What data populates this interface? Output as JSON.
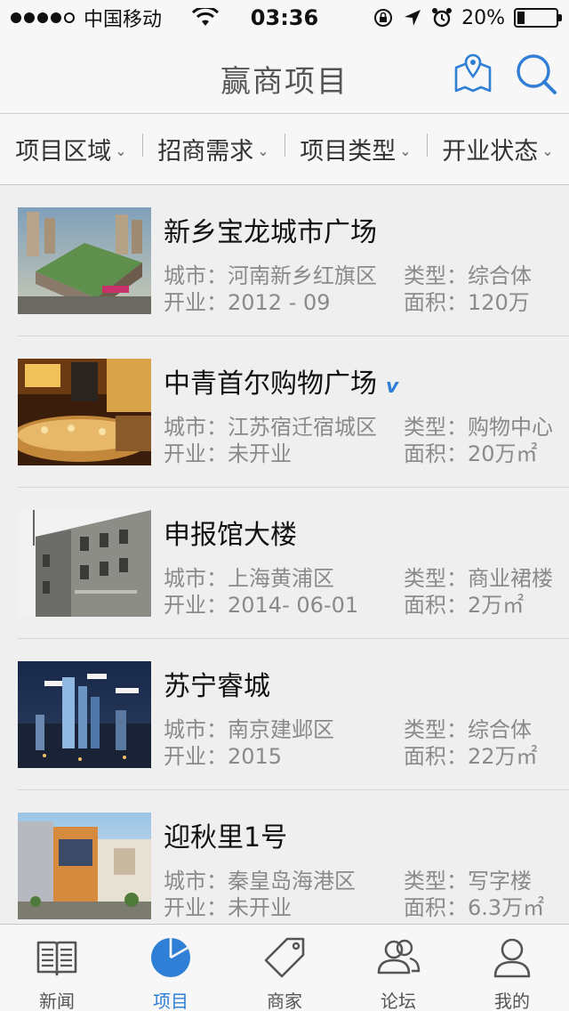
{
  "status_bar": {
    "carrier": "中国移动",
    "time": "03:36",
    "battery_text": "20%",
    "battery_level": 0.2
  },
  "nav": {
    "title": "赢商项目",
    "map_icon": "map-pin-icon",
    "search_icon": "search-icon"
  },
  "filters": [
    {
      "label": "项目区域"
    },
    {
      "label": "招商需求"
    },
    {
      "label": "项目类型"
    },
    {
      "label": "开业状态"
    }
  ],
  "items": [
    {
      "name": "新乡宝龙城市广场",
      "verified": false,
      "city": "城市：河南新乡红旗区",
      "open": "开业：2012 - 09",
      "type": "类型：综合体",
      "area": "面积：120万"
    },
    {
      "name": "中青首尔购物广场",
      "verified": true,
      "city": "城市：江苏宿迁宿城区",
      "open": "开业：未开业",
      "type": "类型：购物中心",
      "area": "面积：20万㎡"
    },
    {
      "name": "申报馆大楼",
      "verified": false,
      "city": "城市：上海黄浦区",
      "open": "开业：2014- 06-01",
      "type": "类型：商业裙楼",
      "area": "面积：2万㎡"
    },
    {
      "name": "苏宁睿城",
      "verified": false,
      "city": "城市：南京建邺区",
      "open": "开业：2015",
      "type": "类型：综合体",
      "area": "面积：22万㎡"
    },
    {
      "name": "迎秋里1号",
      "verified": false,
      "city": "城市：秦皇岛海港区",
      "open": "开业：未开业",
      "type": "类型：写字楼",
      "area": "面积：6.3万㎡"
    }
  ],
  "verified_badge": "v",
  "tabs": [
    {
      "label": "新闻",
      "icon": "newspaper-icon",
      "active": false
    },
    {
      "label": "项目",
      "icon": "pie-chart-icon",
      "active": true
    },
    {
      "label": "商家",
      "icon": "tag-icon",
      "active": false
    },
    {
      "label": "论坛",
      "icon": "users-icon",
      "active": false
    },
    {
      "label": "我的",
      "icon": "user-icon",
      "active": false
    }
  ],
  "colors": {
    "accent": "#2f7fd7",
    "text_secondary": "#8a8a8a"
  }
}
